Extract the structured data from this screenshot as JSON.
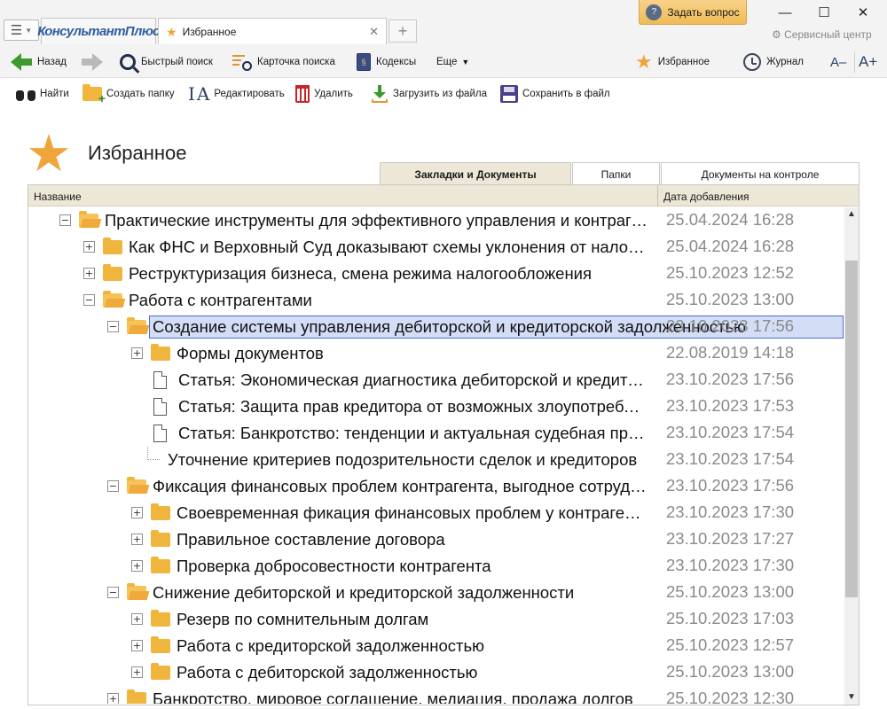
{
  "titlebar": {
    "logo": "КонсультантПлюс",
    "tab_title": "Избранное",
    "ask_button": "Задать вопрос",
    "service_center": "Сервисный центр"
  },
  "navbar": {
    "back": "Назад",
    "quick_search": "Быстрый поиск",
    "search_card": "Карточка поиска",
    "codes": "Кодексы",
    "more": "Еще",
    "favorites": "Избранное",
    "journal": "Журнал",
    "font_decrease": "A–",
    "font_increase": "A+"
  },
  "actions": {
    "find": "Найти",
    "create_folder": "Создать папку",
    "edit": "Редактировать",
    "delete": "Удалить",
    "load_from_file": "Загрузить из файла",
    "save_to_file": "Сохранить в файл"
  },
  "page": {
    "title": "Избранное"
  },
  "tabs": [
    {
      "label": "Закладки и Документы",
      "active": true
    },
    {
      "label": "Папки",
      "active": false
    },
    {
      "label": "Документы на контроле",
      "active": false
    }
  ],
  "table": {
    "col_name": "Название",
    "col_date": "Дата добавления",
    "rows": [
      {
        "name": "Практические инструменты для эффективного управления и контрагентами",
        "date": "25.04.2024 16:28",
        "level": 0,
        "type": "folder",
        "expander": "−",
        "open": true
      },
      {
        "name": "Как ФНС и Верховный Суд доказывают схемы уклонения от налогов",
        "date": "25.04.2024 16:28",
        "level": 1,
        "type": "folder",
        "expander": "+",
        "open": false
      },
      {
        "name": "Реструктуризация бизнеса, смена режима налогообложения",
        "date": "25.10.2023 12:52",
        "level": 1,
        "type": "folder",
        "expander": "+",
        "open": false
      },
      {
        "name": "Работа с контрагентами",
        "date": "25.10.2023 13:00",
        "level": 1,
        "type": "folder",
        "expander": "−",
        "open": true
      },
      {
        "name": "Создание системы управления дебиторской и кредиторской задолженностью",
        "date": "23.10.2023 17:56",
        "level": 2,
        "type": "folder",
        "expander": "−",
        "open": true,
        "selected": true
      },
      {
        "name": "Формы документов",
        "date": "22.08.2019 14:18",
        "level": 3,
        "type": "folder",
        "expander": "+",
        "open": false
      },
      {
        "name": "Статья: Экономическая диагностика дебиторской и кредиторской задолженности",
        "date": "23.10.2023 17:56",
        "level": 3,
        "type": "doc"
      },
      {
        "name": "Статья: Защита прав кредитора от возможных злоупотреблений",
        "date": "23.10.2023 17:53",
        "level": 3,
        "type": "doc"
      },
      {
        "name": "Статья: Банкротство: тенденции и актуальная судебная практика",
        "date": "23.10.2023 17:54",
        "level": 3,
        "type": "doc"
      },
      {
        "name": "Уточнение критериев подозрительности сделок и кредиторов",
        "date": "23.10.2023 17:54",
        "level": 4,
        "type": "bookmark"
      },
      {
        "name": "Фиксация финансовых проблем контрагента, выгодное сотрудничество",
        "date": "23.10.2023 17:56",
        "level": 2,
        "type": "folder",
        "expander": "−",
        "open": true
      },
      {
        "name": "Своевременная фикация финансовых проблем у контрагента",
        "date": "23.10.2023 17:30",
        "level": 3,
        "type": "folder",
        "expander": "+",
        "open": false
      },
      {
        "name": "Правильное составление договора",
        "date": "23.10.2023 17:27",
        "level": 3,
        "type": "folder",
        "expander": "+",
        "open": false
      },
      {
        "name": "Проверка добросовестности контрагента",
        "date": "23.10.2023 17:30",
        "level": 3,
        "type": "folder",
        "expander": "+",
        "open": false
      },
      {
        "name": "Снижение дебиторской и кредиторской задолженности",
        "date": "25.10.2023 13:00",
        "level": 2,
        "type": "folder",
        "expander": "−",
        "open": true
      },
      {
        "name": "Резерв по сомнительным долгам",
        "date": "25.10.2023 17:03",
        "level": 3,
        "type": "folder",
        "expander": "+",
        "open": false
      },
      {
        "name": "Работа с кредиторской задолженностью",
        "date": "25.10.2023 12:57",
        "level": 3,
        "type": "folder",
        "expander": "+",
        "open": false
      },
      {
        "name": "Работа с дебиторской задолженностью",
        "date": "25.10.2023 13:00",
        "level": 3,
        "type": "folder",
        "expander": "+",
        "open": false
      },
      {
        "name": "Банкротство, мировое соглашение, медиация, продажа долгов",
        "date": "25.10.2023 12:30",
        "level": 2,
        "type": "folder",
        "expander": "+",
        "open": false
      }
    ]
  },
  "colors": {
    "accent_star": "#f0a53c",
    "folder": "#f0b53d",
    "selection_bg": "#d3ddf6",
    "selection_border": "#4e6fbf",
    "header_bg": "#ece7d6",
    "date_text": "#8a8a8a"
  }
}
